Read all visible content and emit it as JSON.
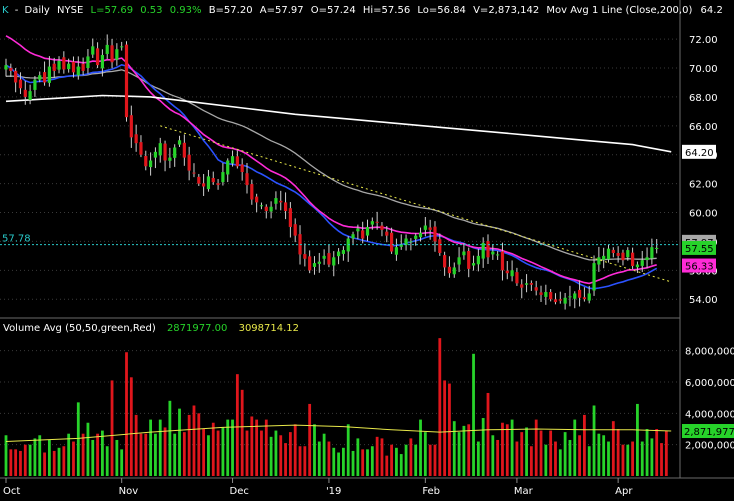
{
  "header": {
    "symbol": "K",
    "period": "Daily",
    "exchange": "NYSE",
    "last": "L=57.69",
    "change": "0.53",
    "change_pct": "0.93%",
    "bid": "B=57.20",
    "ask": "A=57.97",
    "open": "O=57.24",
    "high": "Hi=57.56",
    "low": "Lo=56.84",
    "volume": "V=2,873,142",
    "ma_desc": "Mov Avg 1 Line (Close,200,0)",
    "ma_value": "64.2"
  },
  "volume_header": {
    "title": "Volume Avg (50,50,green,Red)",
    "v1": "2871977.00",
    "v2": "3098714.12"
  },
  "colors": {
    "background": "#000000",
    "up": "#27d32a",
    "down": "#e0161c",
    "ma_blue": "#2b52ff",
    "ma_magenta": "#ff2bd8",
    "ma_gray": "#a8a8a8",
    "ma_white": "#ffffff",
    "trendline": "#e8e84a",
    "ref_line": "#28c8c8",
    "vol_avg": "#e8e84a",
    "grid": "#3a3a3a"
  },
  "chart_data": {
    "type": "candlestick",
    "price_axis": {
      "ticks": [
        "72.00",
        "70.00",
        "68.00",
        "66.00",
        "64.00",
        "62.00",
        "60.00",
        "58.00",
        "56.00",
        "54.00"
      ],
      "ylim": [
        52.7,
        73.6
      ]
    },
    "volume_axis": {
      "ticks": [
        "8,000,000",
        "6,000,000",
        "4,000,000",
        "2,000,000"
      ],
      "ylim": [
        0,
        9000000
      ]
    },
    "x_labels": [
      "Oct",
      "Nov",
      "Dec",
      "'19",
      "Feb",
      "Mar",
      "Apr"
    ],
    "x_label_bar_index": [
      0,
      24,
      47,
      67,
      87,
      106,
      127
    ],
    "price_tags": [
      {
        "label": "64.20",
        "value": 64.2,
        "bg": "#ffffff",
        "fg": "#000000"
      },
      {
        "label": "57.97",
        "value": 57.97,
        "bg": "#a8a8a8",
        "fg": "#000000"
      },
      {
        "label": "57.55",
        "value": 57.55,
        "bg": "#27d32a",
        "fg": "#000000"
      },
      {
        "label": "56.33",
        "value": 56.33,
        "bg": "#ff2bd8",
        "fg": "#000000"
      }
    ],
    "volume_tag": {
      "label": "2,871,977",
      "value": 2871977,
      "bg": "#27d32a",
      "fg": "#000000"
    },
    "ref_line": {
      "label": "57.78",
      "value": 57.78
    },
    "trendline": {
      "from": {
        "bar": 32,
        "value": 66.0
      },
      "to": {
        "bar": 138,
        "value": 55.2
      }
    },
    "closes": [
      70.2,
      69.8,
      69.0,
      68.6,
      68.0,
      68.4,
      69.2,
      69.5,
      69.0,
      70.1,
      69.8,
      70.5,
      69.9,
      70.3,
      69.7,
      70.1,
      69.8,
      70.8,
      71.5,
      70.2,
      70.9,
      71.6,
      70.4,
      71.3,
      71.5,
      66.6,
      65.2,
      64.8,
      64.0,
      63.2,
      63.6,
      64.2,
      64.8,
      63.6,
      63.8,
      64.5,
      65.0,
      63.8,
      62.9,
      62.7,
      62.0,
      61.8,
      62.5,
      62.1,
      61.9,
      62.8,
      63.6,
      63.9,
      63.2,
      62.8,
      61.9,
      60.9,
      60.7,
      60.5,
      60.1,
      60.4,
      61.0,
      60.7,
      60.1,
      59.0,
      58.4,
      57.1,
      56.8,
      56.0,
      56.5,
      56.6,
      57.0,
      56.4,
      56.9,
      57.3,
      57.4,
      58.2,
      58.5,
      58.9,
      58.2,
      59.0,
      59.4,
      59.3,
      58.8,
      58.4,
      57.3,
      57.6,
      57.8,
      58.2,
      58.0,
      58.4,
      58.6,
      59.1,
      58.8,
      58.0,
      57.2,
      56.2,
      55.8,
      56.2,
      56.9,
      57.3,
      56.1,
      56.5,
      57.0,
      57.9,
      56.9,
      57.3,
      57.1,
      56.0,
      55.8,
      56.0,
      55.1,
      54.8,
      55.1,
      55.0,
      54.6,
      54.3,
      54.5,
      54.0,
      53.8,
      53.9,
      54.1,
      54.2,
      54.4,
      54.1,
      54.0,
      54.4,
      56.5,
      56.9,
      57.0,
      57.5,
      57.2,
      57.0,
      56.7,
      57.4,
      56.3,
      56.4,
      56.7,
      56.9,
      57.6,
      57.55
    ],
    "series": [
      {
        "name": "Mov Avg 1 Line (Close,200,0)",
        "type": "line",
        "color": "#ffffff",
        "x": [
          0,
          10,
          20,
          30,
          40,
          50,
          60,
          70,
          80,
          90,
          100,
          110,
          120,
          130,
          138
        ],
        "values": [
          67.7,
          67.9,
          68.1,
          68.0,
          67.6,
          67.2,
          66.8,
          66.5,
          66.2,
          65.9,
          65.6,
          65.3,
          65.0,
          64.7,
          64.2
        ]
      }
    ],
    "volume": [
      2600000,
      1700000,
      1700000,
      1600000,
      2000000,
      2000000,
      2400000,
      2600000,
      1500000,
      2300000,
      1600000,
      1800000,
      1900000,
      2700000,
      2200000,
      4700000,
      2700000,
      3400000,
      2300000,
      2700000,
      2900000,
      1900000,
      6100000,
      2300000,
      1700000,
      7900000,
      6300000,
      3900000,
      2700000,
      2700000,
      3600000,
      2700000,
      3600000,
      3100000,
      4800000,
      2700000,
      4300000,
      2800000,
      3900000,
      4500000,
      4000000,
      3000000,
      2600000,
      3400000,
      2900000,
      3100000,
      3600000,
      3600000,
      6500000,
      5500000,
      2900000,
      3800000,
      3600000,
      2900000,
      3600000,
      2500000,
      2900000,
      2600000,
      2100000,
      2800000,
      3300000,
      1900000,
      1900000,
      4600000,
      3300000,
      2200000,
      2700000,
      2200000,
      1800000,
      1500000,
      1800000,
      3300000,
      1600000,
      2400000,
      1700000,
      1700000,
      1900000,
      2500000,
      2400000,
      1300000,
      2000000,
      1800000,
      1400000,
      2000000,
      2400000,
      2000000,
      3600000,
      2800000,
      2000000,
      2000000,
      8800000,
      6100000,
      5900000,
      3500000,
      2800000,
      3200000,
      3300000,
      7800000,
      2200000,
      3700000,
      5300000,
      2600000,
      2300000,
      3400000,
      3300000,
      3600000,
      2200000,
      2800000,
      3100000,
      1900000,
      3600000,
      2900000,
      2000000,
      2900000,
      2200000,
      1700000,
      2800000,
      2300000,
      3600000,
      2600000,
      3900000,
      1900000,
      4500000,
      2700000,
      2600000,
      2200000,
      3500000,
      3000000,
      2000000,
      2000000,
      2200000,
      4600000,
      2200000,
      3000000,
      2400000,
      3000000,
      2100000,
      2900000
    ],
    "volume_avg": {
      "x": [
        0,
        15,
        30,
        45,
        60,
        70,
        80,
        90,
        100,
        110,
        120,
        130,
        138
      ],
      "values": [
        2200000,
        2400000,
        2800000,
        3100000,
        3250000,
        3150000,
        2950000,
        2800000,
        2950000,
        3000000,
        2950000,
        2950000,
        2871977
      ]
    }
  }
}
